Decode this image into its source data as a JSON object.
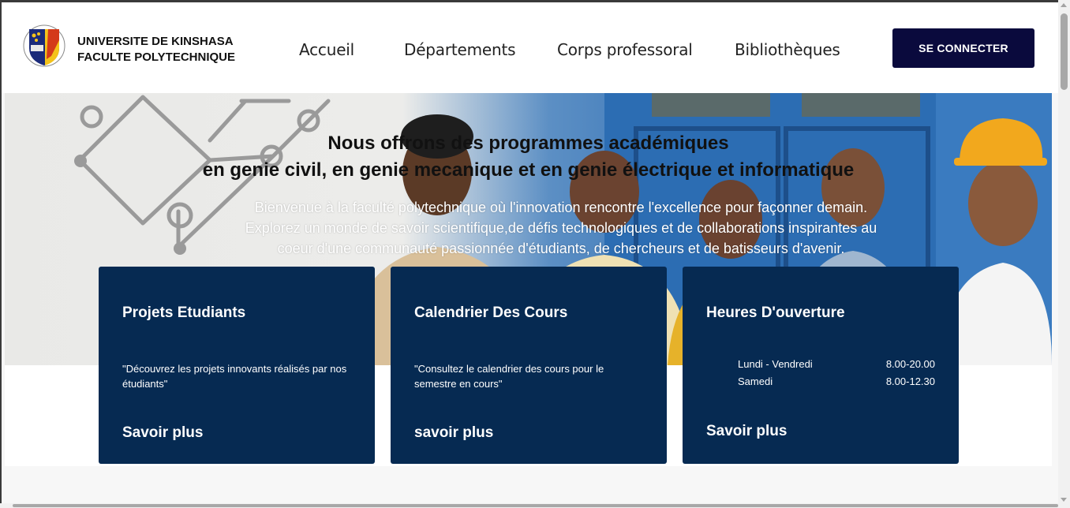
{
  "brand": {
    "line1": "UNIVERSITE DE KINSHASA",
    "line2": "FACULTE POLYTECHNIQUE",
    "logo_icon": "university-shield-logo"
  },
  "nav": {
    "items": [
      {
        "label": "Accueil"
      },
      {
        "label": "Départements"
      },
      {
        "label": "Corps professoral"
      },
      {
        "label": "Bibliothèques"
      }
    ],
    "login_label": "SE CONNECTER"
  },
  "hero": {
    "title_line1": "Nous offrons des programmes académiques",
    "title_line2": "en genie civil, en genie mecanique et en genie électrique et informatique",
    "text_line1": "Bienvenue à la faculté polytechnique où l'innovation rencontre l'excellence pour façonner demain.",
    "text_line2": "Explorez un monde de savoir scientifique,de défis technologiques et de collaborations inspirantes au",
    "text_line3": "coeur d'une communauté passionnée d'étudiants, de chercheurs et de batisseurs d'avenir."
  },
  "cards": [
    {
      "title": "Projets Etudiants",
      "text": "\"Découvrez les projets innovants réalisés par nos étudiants\"",
      "link": "Savoir plus"
    },
    {
      "title": "Calendrier Des Cours",
      "text": "\"Consultez le calendrier des cours pour le semestre en cours\"",
      "link": "savoir plus"
    },
    {
      "title": "Heures D'ouverture",
      "hours": [
        {
          "day": "Lundi - Vendredi",
          "time": "8.00-20.00"
        },
        {
          "day": "Samedi",
          "time": "8.00-12.30"
        }
      ],
      "link": "Savoir plus"
    }
  ],
  "colors": {
    "navy_button": "#0a0a3d",
    "card_bg": "#062a52"
  }
}
